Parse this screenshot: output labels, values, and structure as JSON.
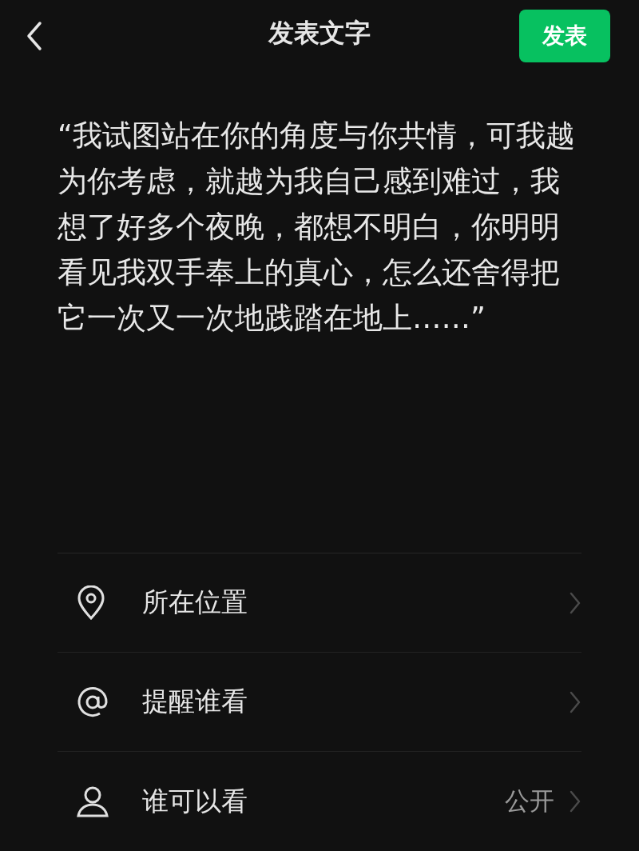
{
  "header": {
    "title": "发表文字",
    "publish_button": "发表"
  },
  "post_text": "“我试图站在你的角度与你共情，可我越为你考虑，就越为我自己感到难过，我想了好多个夜晚，都想不明白，你明明看见我双手奉上的真心，怎么还舍得把它一次又一次地践踏在地上……”",
  "options": [
    {
      "kind": "location",
      "label": "所在位置"
    },
    {
      "kind": "mention",
      "label": "提醒谁看"
    },
    {
      "kind": "visibility",
      "label": "谁可以看",
      "value": "公开"
    }
  ]
}
